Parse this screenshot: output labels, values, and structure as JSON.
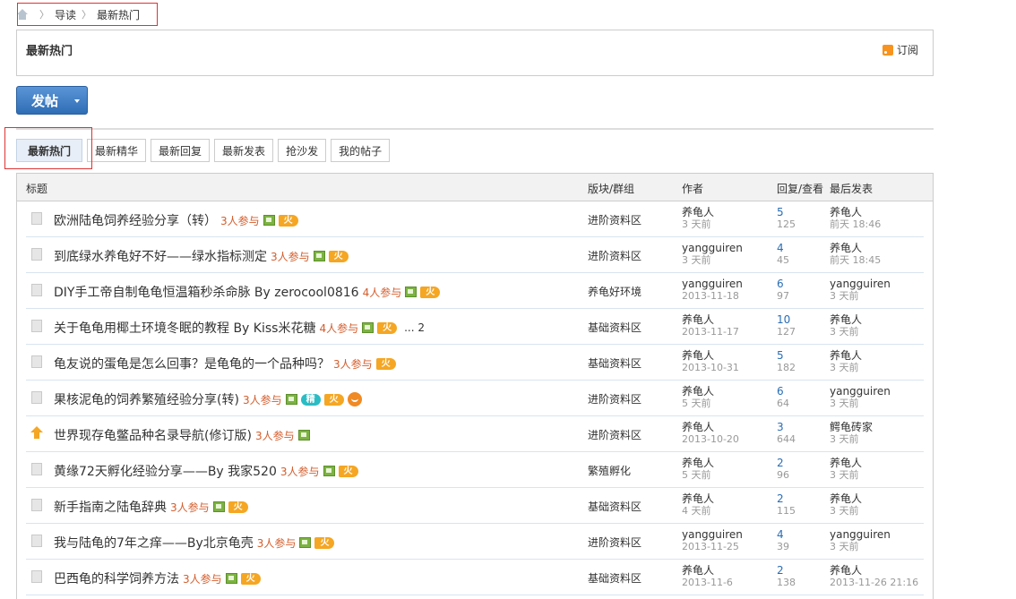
{
  "breadcrumb": {
    "home_icon": "home-icon",
    "items": [
      "导读",
      "最新热门"
    ]
  },
  "header": {
    "title": "最新热门",
    "subscribe_label": "订阅"
  },
  "post_button": {
    "label": "发帖"
  },
  "tabs": [
    "最新热门",
    "最新精华",
    "最新回复",
    "最新发表",
    "抢沙发",
    "我的帖子"
  ],
  "table": {
    "headers": {
      "title": "标题",
      "forum": "版块/群组",
      "author": "作者",
      "stats": "回复/查看",
      "last": "最后发表"
    },
    "rows": [
      {
        "title": "欧洲陆龟饲养经验分享（转）",
        "join": "3人参与",
        "icons": [
          "img",
          "hot"
        ],
        "pages": "",
        "forum": "进阶资料区",
        "author": "养龟人",
        "author_time": "3 天前",
        "replies": "5",
        "views": "125",
        "last_user": "养龟人",
        "last_time": "前天 18:46",
        "top": false
      },
      {
        "title": "到底绿水养龟好不好——绿水指标测定",
        "join": "3人参与",
        "icons": [
          "img",
          "hot"
        ],
        "pages": "",
        "forum": "进阶资料区",
        "author": "yangguiren",
        "author_time": "3 天前",
        "replies": "4",
        "views": "45",
        "last_user": "养龟人",
        "last_time": "前天 18:45",
        "top": false
      },
      {
        "title": "DIY手工帝自制龟龟恒温箱秒杀命脉  By zerocool0816",
        "join": "4人参与",
        "icons": [
          "img",
          "hot"
        ],
        "pages": "",
        "forum": "养龟好环境",
        "author": "yangguiren",
        "author_time": "2013-11-18",
        "replies": "6",
        "views": "97",
        "last_user": "yangguiren",
        "last_time": "3 天前",
        "top": false
      },
      {
        "title": "关于龟龟用椰土环境冬眠的教程  By Kiss米花糖",
        "join": "4人参与",
        "icons": [
          "img",
          "hot"
        ],
        "pages": "... 2",
        "forum": "基础资料区",
        "author": "养龟人",
        "author_time": "2013-11-17",
        "replies": "10",
        "views": "127",
        "last_user": "养龟人",
        "last_time": "3 天前",
        "top": false
      },
      {
        "title": "龟友说的蛋龟是怎么回事？是龟龟的一个品种吗？",
        "join": "3人参与",
        "icons": [
          "hot"
        ],
        "pages": "",
        "forum": "基础资料区",
        "author": "养龟人",
        "author_time": "2013-10-31",
        "replies": "5",
        "views": "182",
        "last_user": "养龟人",
        "last_time": "3 天前",
        "top": false
      },
      {
        "title": "果核泥龟的饲养繁殖经验分享(转)",
        "join": "3人参与",
        "icons": [
          "img",
          "jing",
          "hot",
          "smile"
        ],
        "pages": "",
        "forum": "进阶资料区",
        "author": "养龟人",
        "author_time": "5 天前",
        "replies": "6",
        "views": "64",
        "last_user": "yangguiren",
        "last_time": "3 天前",
        "top": false
      },
      {
        "title": "世界现存龟鳖品种名录导航(修订版)",
        "join": "3人参与",
        "icons": [
          "img"
        ],
        "pages": "",
        "forum": "进阶资料区",
        "author": "养龟人",
        "author_time": "2013-10-20",
        "replies": "3",
        "views": "644",
        "last_user": "鳄龟砖家",
        "last_time": "3 天前",
        "top": true
      },
      {
        "title": "黄缘72天孵化经验分享——By 我家520",
        "join": "3人参与",
        "icons": [
          "img",
          "hot"
        ],
        "pages": "",
        "forum": "繁殖孵化",
        "author": "养龟人",
        "author_time": "5 天前",
        "replies": "2",
        "views": "96",
        "last_user": "养龟人",
        "last_time": "3 天前",
        "top": false
      },
      {
        "title": "新手指南之陆龟辞典",
        "join": "3人参与",
        "icons": [
          "img",
          "hot"
        ],
        "pages": "",
        "forum": "基础资料区",
        "author": "养龟人",
        "author_time": "4 天前",
        "replies": "2",
        "views": "115",
        "last_user": "养龟人",
        "last_time": "3 天前",
        "top": false
      },
      {
        "title": "我与陆龟的7年之痒——By北京龟壳",
        "join": "3人参与",
        "icons": [
          "img",
          "hot"
        ],
        "pages": "",
        "forum": "进阶资料区",
        "author": "yangguiren",
        "author_time": "2013-11-25",
        "replies": "4",
        "views": "39",
        "last_user": "yangguiren",
        "last_time": "3 天前",
        "top": false
      },
      {
        "title": "巴西龟的科学饲养方法",
        "join": "3人参与",
        "icons": [
          "img",
          "hot"
        ],
        "pages": "",
        "forum": "基础资料区",
        "author": "养龟人",
        "author_time": "2013-11-6",
        "replies": "2",
        "views": "138",
        "last_user": "养龟人",
        "last_time": "2013-11-26 21:16",
        "top": false
      }
    ]
  },
  "icon_glyphs": {
    "hot": "火",
    "jing": "精"
  }
}
